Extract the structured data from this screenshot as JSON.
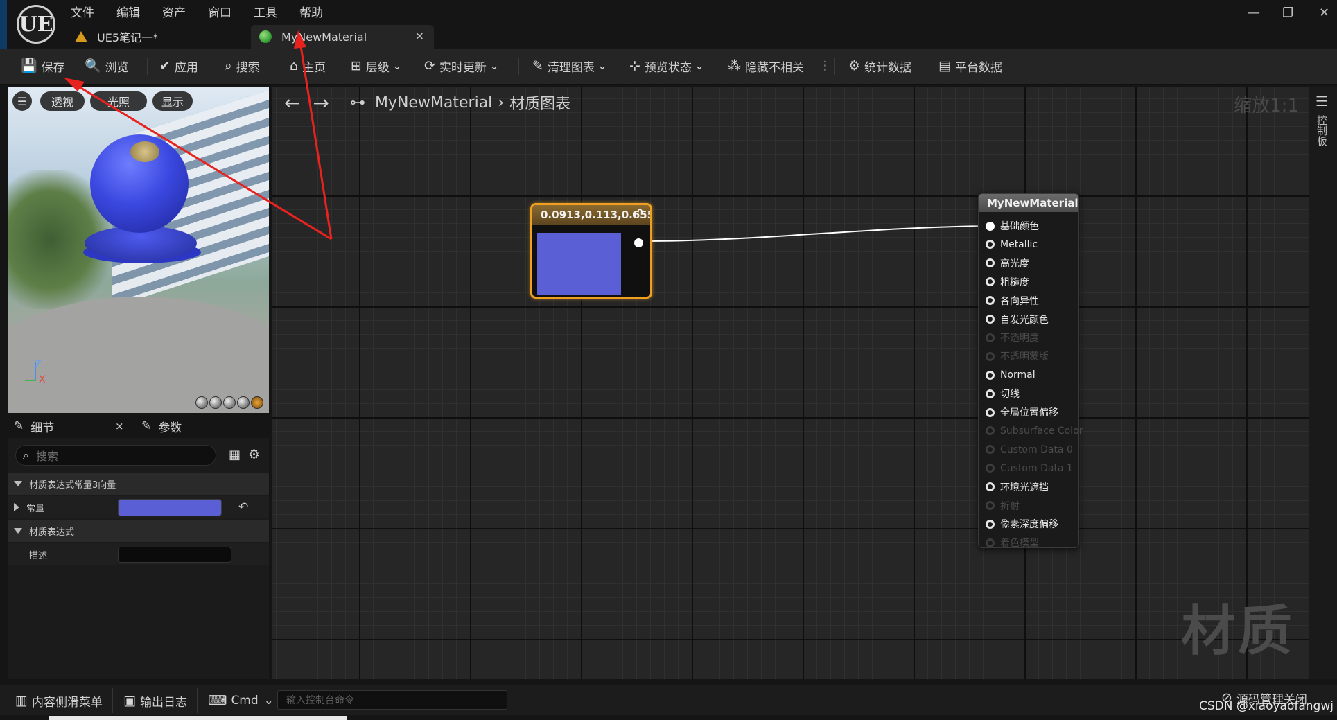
{
  "app": {
    "logo": "UE"
  },
  "menu": [
    "文件",
    "编辑",
    "资产",
    "窗口",
    "工具",
    "帮助"
  ],
  "window_controls": {
    "minimize": "—",
    "restore": "❐",
    "close": "✕"
  },
  "doc_tabs": [
    {
      "label": "UE5笔记一*",
      "icon": "ue5-warning-icon"
    },
    {
      "label": "MyNewMaterial",
      "icon": "material-icon",
      "close": "×"
    }
  ],
  "toolbar": {
    "save": "保存",
    "browse": "浏览",
    "apply": "应用",
    "search": "搜索",
    "home": "主页",
    "hierarchy": "层级",
    "live_update": "实时更新",
    "clean_graph": "清理图表",
    "preview_state": "预览状态",
    "hide_unrelated": "隐藏不相关",
    "more": "⋮",
    "stats": "统计数据",
    "platform_stats": "平台数据"
  },
  "viewport": {
    "menu_icon": "☰",
    "perspective": "透视",
    "lit": "光照",
    "show": "显示",
    "axis_z": "Z",
    "axis_x": "X"
  },
  "details": {
    "tab_details": "细节",
    "tab_details_close": "×",
    "tab_params": "参数",
    "search_placeholder": "搜索",
    "section1": "材质表达式常量3向量",
    "constant_label": "常量",
    "constant_color": "#5a5fd5",
    "reset_icon": "↶",
    "section2": "材质表达式",
    "desc_label": "描述",
    "desc_value": ""
  },
  "graph": {
    "back": "←",
    "forward": "→",
    "material_name": "MyNewMaterial",
    "separator": "›",
    "graph_name": "材质图表",
    "zoom": "缩放1:1",
    "watermark": "材质",
    "const_node": {
      "title": "0.0913,0.113,0.655",
      "collapse": "^",
      "color": "#5a5fd5"
    },
    "result_node": {
      "title": "MyNewMaterial",
      "pins": [
        {
          "label": "基础颜色",
          "enabled": true,
          "connected": true
        },
        {
          "label": "Metallic",
          "enabled": true
        },
        {
          "label": "高光度",
          "enabled": true
        },
        {
          "label": "粗糙度",
          "enabled": true
        },
        {
          "label": "各向异性",
          "enabled": true
        },
        {
          "label": "自发光颜色",
          "enabled": true
        },
        {
          "label": "不透明度",
          "enabled": false
        },
        {
          "label": "不透明蒙版",
          "enabled": false
        },
        {
          "label": "Normal",
          "enabled": true
        },
        {
          "label": "切线",
          "enabled": true
        },
        {
          "label": "全局位置偏移",
          "enabled": true
        },
        {
          "label": "Subsurface Color",
          "enabled": false
        },
        {
          "label": "Custom Data 0",
          "enabled": false
        },
        {
          "label": "Custom Data 1",
          "enabled": false
        },
        {
          "label": "环境光遮挡",
          "enabled": true
        },
        {
          "label": "折射",
          "enabled": false
        },
        {
          "label": "像素深度偏移",
          "enabled": true
        },
        {
          "label": "着色模型",
          "enabled": false
        }
      ]
    }
  },
  "right_panel": {
    "icon": "☰",
    "label": "控制板"
  },
  "statusbar": {
    "content_drawer": "内容侧滑菜单",
    "output_log": "输出日志",
    "cmd": "Cmd",
    "console_placeholder": "输入控制台命令",
    "source_control": "源码管理关闭"
  },
  "watermark_csdn": "CSDN @xiaoyaofangwj"
}
